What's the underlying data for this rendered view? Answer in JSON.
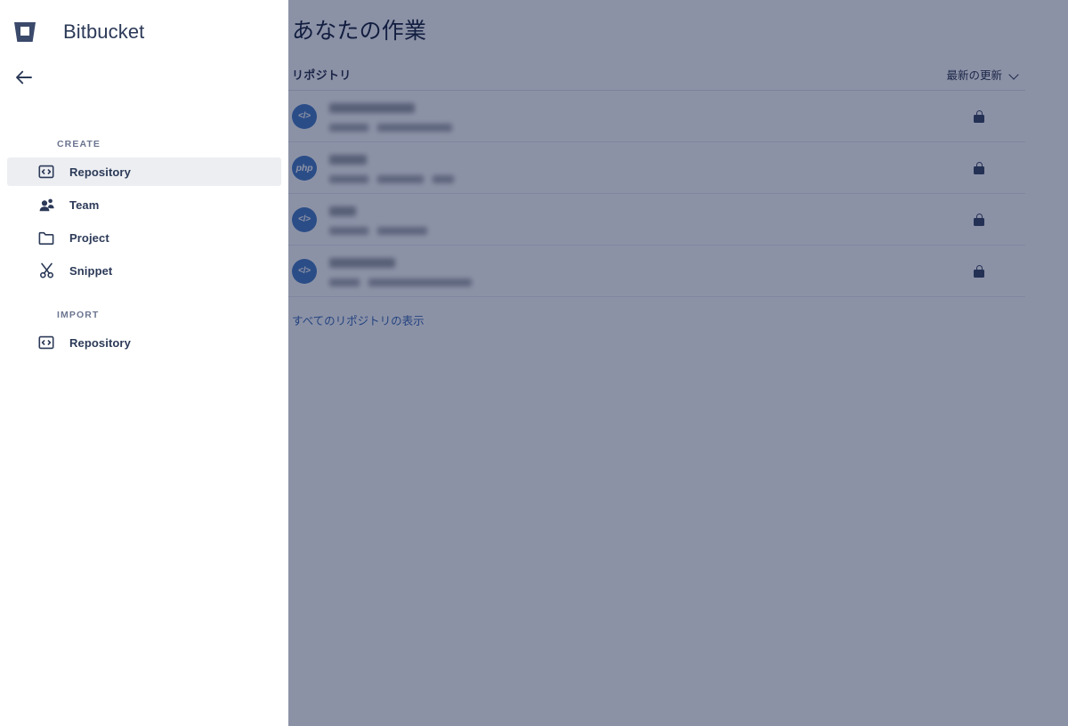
{
  "drawer": {
    "logo_icon": "bitbucket-logo-icon",
    "title": "Bitbucket",
    "back_icon": "arrow-left-icon",
    "groups": [
      {
        "label": "CREATE",
        "items": [
          {
            "icon": "code-repository-icon",
            "label": "Repository",
            "selected": true
          },
          {
            "icon": "people-team-icon",
            "label": "Team",
            "selected": false
          },
          {
            "icon": "folder-project-icon",
            "label": "Project",
            "selected": false
          },
          {
            "icon": "scissors-snippet-icon",
            "label": "Snippet",
            "selected": false
          }
        ]
      },
      {
        "label": "IMPORT",
        "items": [
          {
            "icon": "code-repository-icon",
            "label": "Repository",
            "selected": false
          }
        ]
      }
    ]
  },
  "main": {
    "title": "あなたの作業",
    "section_label": "リポジトリ",
    "sort": {
      "label": "最新の更新",
      "chevron_icon": "chevron-down-icon"
    },
    "repositories": [
      {
        "avatar_icon": "code-avatar-icon",
        "avatar_text": "</>",
        "avatar_type": "code",
        "name_width": 96,
        "meta_widths": [
          44,
          84
        ],
        "lock_icon": "lock-icon",
        "private": true
      },
      {
        "avatar_icon": "php-avatar-icon",
        "avatar_text": "php",
        "avatar_type": "php",
        "name_width": 42,
        "meta_widths": [
          44,
          52,
          24
        ],
        "lock_icon": "lock-icon",
        "private": true
      },
      {
        "avatar_icon": "code-avatar-icon",
        "avatar_text": "</>",
        "avatar_type": "code",
        "name_width": 30,
        "meta_widths": [
          44,
          56
        ],
        "lock_icon": "lock-icon",
        "private": true
      },
      {
        "avatar_icon": "code-avatar-icon",
        "avatar_text": "</>",
        "avatar_type": "code",
        "name_width": 74,
        "meta_widths": [
          34,
          116
        ],
        "lock_icon": "lock-icon",
        "private": true
      }
    ],
    "view_all_label": "すべてのリポジトリの表示"
  },
  "colors": {
    "brand_navy": "#2c3a58",
    "avatar_blue": "#3d74c0",
    "link_blue": "#2a5fb0",
    "veil": "rgba(26,38,77,0.50)",
    "selected_row": "#eceef2"
  }
}
